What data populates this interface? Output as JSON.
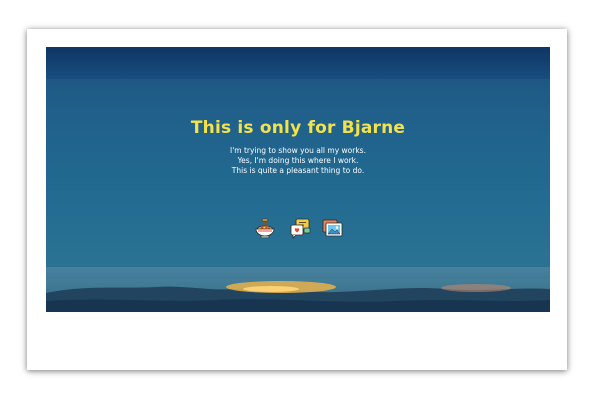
{
  "hero": {
    "title": "This is only for Bjarne",
    "lines": [
      "I'm trying to show you all my works.",
      "Yes, I'm doing this where I work.",
      "This is quite a pleasant thing to do."
    ]
  },
  "icons": [
    "pasta-bowl-icon",
    "chat-bubbles-icon",
    "photo-gallery-icon"
  ],
  "colors": {
    "title": "#f4e24a",
    "text": "#ffffff",
    "sky": "#1e6d95"
  }
}
